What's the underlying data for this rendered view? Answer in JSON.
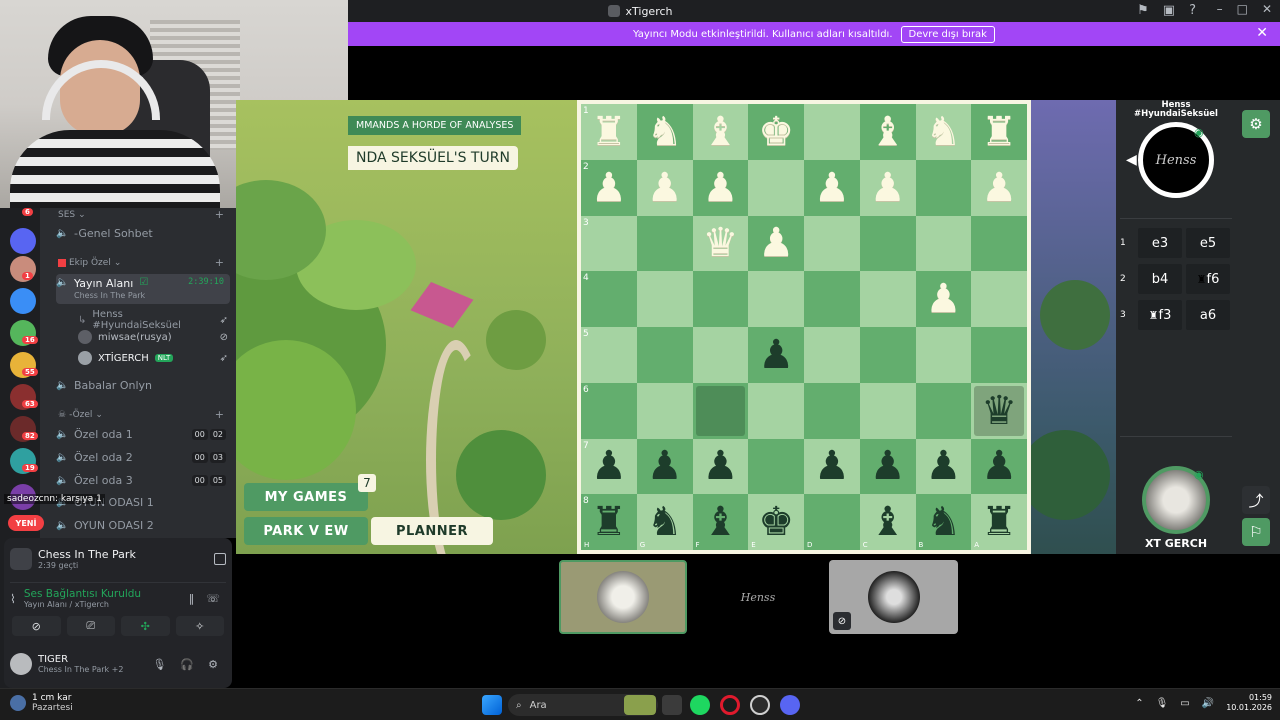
{
  "window": {
    "title": "xTigerch"
  },
  "banner": {
    "text": "Yayıncı Modu etkinleştirildi. Kullanıcı adları kısaltıldı.",
    "button": "Devre dışı bırak"
  },
  "sidebar": {
    "categories": [
      "SES",
      "Ekip Özel",
      "-Özel"
    ],
    "channels": {
      "genel": "-Genel Sohbet",
      "yayin": "Yayın Alanı",
      "yayin_time": "2:39:10",
      "yayin_sub": "Chess In The Park",
      "babalar": "Babalar Onlyn",
      "ozel1": "Özel oda 1",
      "ozel2": "Özel oda 2",
      "ozel3": "Özel oda 3",
      "oyun1": "OYUN ODASI 1",
      "oyun2": "OYUN ODASI 2"
    },
    "counts": {
      "ozel1": [
        "00",
        "02"
      ],
      "ozel2": [
        "00",
        "03"
      ],
      "ozel3": [
        "00",
        "05"
      ]
    },
    "users": [
      "Henss #HyundaiSeksüel",
      "miwsae(rusya)",
      "XTİGERCH"
    ],
    "user_badge": "NLT",
    "server_badges": [
      "6",
      "1",
      "16",
      "55",
      "63",
      "82",
      "19"
    ],
    "new_label": "YENİ",
    "overlay_text": "sadeozcnn: karşıya 1"
  },
  "panel": {
    "activity": {
      "title": "Chess In The Park",
      "sub": "2:39 geçti"
    },
    "voice": {
      "status": "Ses Bağlantısı Kuruldu",
      "channel": "Yayın Alanı / xTigerch"
    },
    "me": {
      "name": "TIGER",
      "status": "Chess In The Park +2"
    }
  },
  "game": {
    "command_label": "MMANDS A HORDE OF ANALYSES",
    "turn_label": "NDA SEKSÜEL'S TURN",
    "buttons": {
      "my_games": "MY GAMES",
      "my_games_count": "7",
      "park_view": "PARK V EW",
      "planner": "PLANNER"
    },
    "ranks": [
      "1",
      "2",
      "3",
      "4",
      "5",
      "6",
      "7",
      "8"
    ],
    "files": [
      "H",
      "G",
      "F",
      "E",
      "D",
      "C",
      "B",
      "A"
    ],
    "board": [
      "RNBK.BNR",
      "PPP.PP.P",
      "..QP....",
      "......P.",
      "...p....",
      ".......q",
      "ppp.pppp",
      "rnbk.bnr"
    ],
    "highlights": [
      [
        5,
        2
      ],
      [
        5,
        7
      ]
    ]
  },
  "rpanel": {
    "top_player": "Henss",
    "top_player_sub": "#HyundaiSeksüel",
    "top_avatar_text": "Henss",
    "bottom_player": "XT GERCH",
    "moves": [
      {
        "n": "1",
        "w": "e3",
        "b": "e5"
      },
      {
        "n": "2",
        "w": "b4",
        "b": "f6"
      },
      {
        "n": "3",
        "w": "f3",
        "b": "a6"
      }
    ]
  },
  "thumbs": {
    "middle_text": "Henss"
  },
  "taskbar": {
    "weather": "1 cm kar",
    "day": "Pazartesi",
    "search": "Ara",
    "time": "01:59",
    "date": "10.01.2026"
  },
  "colors": {
    "accent": "#a246f6",
    "board_light": "#a5d3a2",
    "board_dark": "#63ae6e",
    "green_button": "#4f9a63"
  }
}
